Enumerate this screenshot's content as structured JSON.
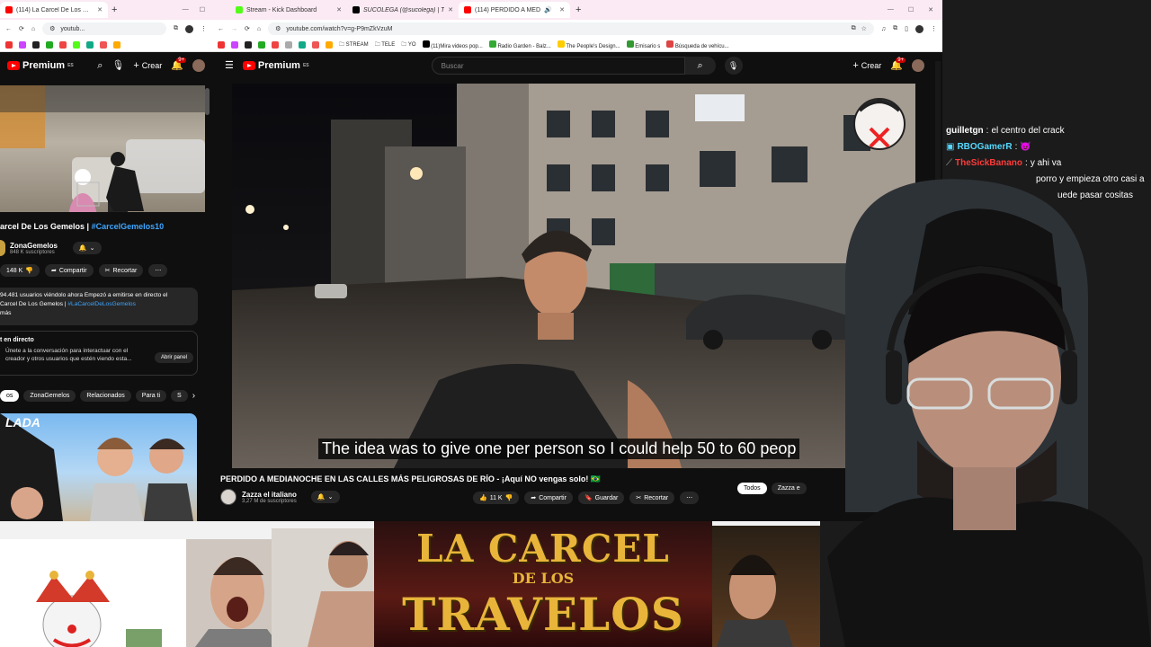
{
  "left_browser": {
    "tabs": [
      {
        "label": "(114) La Carcel De Los Gemelos",
        "color": "#ff0000",
        "active": true
      }
    ],
    "url": "youtub...",
    "header": {
      "premium": "Premium",
      "premium_sup": "ES",
      "crear": "Crear",
      "notif_count": "9+"
    },
    "video": {
      "title_prefix": "arcel De Los Gemelos | ",
      "title_tag": "#CarcelGemelos10",
      "channel": "ZonaGemelos",
      "subs": "848 K suscriptores",
      "likes": "148 K",
      "share": "Compartir",
      "clip": "Recortar"
    },
    "description": {
      "line1": "94.481 usuarios viéndolo ahora  Empezó a emitirse en directo el",
      "line2_prefix": "Carcel De Los Gemelos | ",
      "line2_tag": "#LaCarcelDeLosGemelos",
      "line3": "más"
    },
    "live_chat": {
      "title": "t en directo",
      "text1": "Únete a la conversación para interactuar con el",
      "text2": "creador y otros usuarios que estén viendo esta...",
      "button": "Abrir panel"
    },
    "chips": [
      "os",
      "ZonaGemelos",
      "Relacionados",
      "Para ti",
      "S"
    ],
    "thumb_text": "LADA"
  },
  "main_browser": {
    "tabs": [
      {
        "label": "Stream - Kick Dashboard",
        "color": "#53fc18"
      },
      {
        "label": "SUCOLEGA (@sucolega) | TikT",
        "color": "#000000"
      },
      {
        "label": "(114) PERDIDO A MEDIANO",
        "color": "#ff0000",
        "active": true
      }
    ],
    "url": "youtube.com/watch?v=g-P9mZkVzuM",
    "bookmarks": [
      "STREAM",
      "TELE",
      "YO",
      "(11)Mira videos pop...",
      "Radio Garden - Balz...",
      "The People's Design...",
      "Emisario s",
      "Búsqueda de vehícu..."
    ],
    "header": {
      "premium": "Premium",
      "premium_sup": "ES",
      "search_placeholder": "Buscar",
      "crear": "Crear",
      "notif_count": "9+"
    },
    "video": {
      "subtitle": "The idea was to give one per person so I could help 50 to 60 peop",
      "title": "PERDIDO A MEDIANOCHE EN LAS CALLES MÁS PELIGROSAS DE RÍO - ¡Aquí NO vengas solo! 🇧🇷",
      "channel": "Zazza el italiano",
      "subs": "3,27 M de suscriptores",
      "likes": "11 K",
      "share": "Compartir",
      "save": "Guardar",
      "clip": "Recortar",
      "chips": [
        "Todos",
        "Zazza e"
      ]
    }
  },
  "chat": {
    "lines": [
      {
        "user": "guilletgn",
        "user_color": "#ffffff",
        "text": "el centro del crack"
      },
      {
        "user": "RBOGamerR",
        "user_color": "#55d8ff",
        "text": "😈"
      },
      {
        "user": "TheSickBanano",
        "user_color": "#ff3b3b",
        "text": "y ahi va"
      },
      {
        "user": "",
        "user_color": "#ffffff",
        "text": "porro y empieza otro casi a"
      },
      {
        "user": "",
        "user_color": "#ffffff",
        "text": "uede pasar cositas"
      }
    ]
  },
  "bottom_strip": {
    "banner_line1": "LA CARCEL",
    "banner_line2": "DE LOS",
    "banner_line3": "TRAVELOS"
  },
  "colors": {
    "yt_red": "#ff0000",
    "link_blue": "#3ea6ff",
    "gold": "#e8b53a"
  }
}
